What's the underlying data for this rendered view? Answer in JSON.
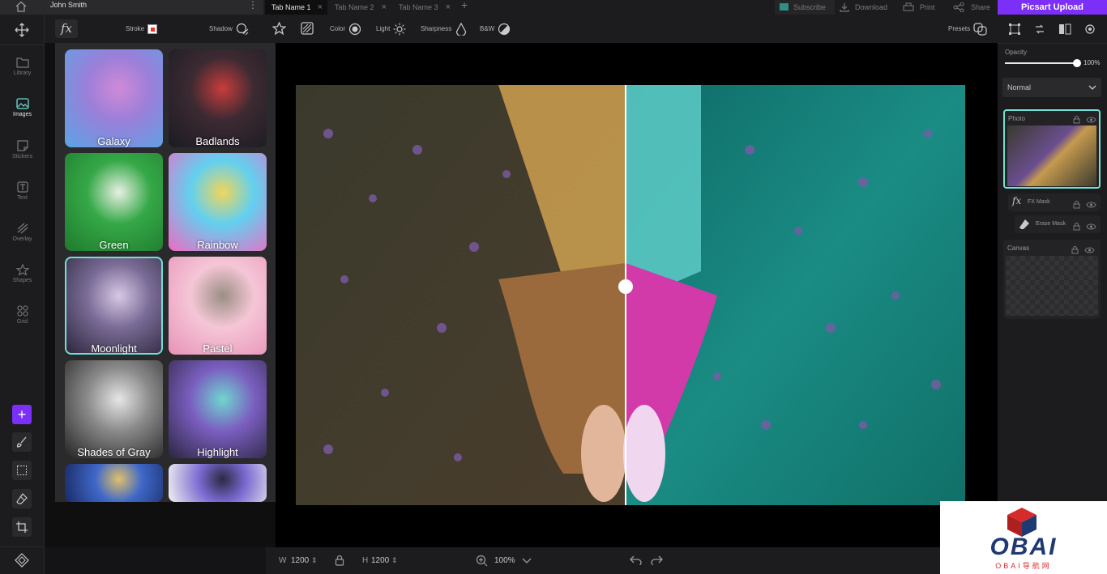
{
  "window": {
    "user_name": "John Smith"
  },
  "tabs": [
    {
      "label": "Tab Name 1",
      "active": true
    },
    {
      "label": "Tab Name 2",
      "active": false
    },
    {
      "label": "Tab Name 3",
      "active": false
    }
  ],
  "top_actions": {
    "subscribe": "Subscribe",
    "download": "Download",
    "print": "Print",
    "share": "Share",
    "upload": "Picsart Upload"
  },
  "effect_tools": {
    "fx_label": "fx",
    "stroke": "Stroke",
    "shadow": "Shadow",
    "color": "Color",
    "light": "Light",
    "sharpness": "Sharpness",
    "bw": "B&W",
    "presets": "Presets"
  },
  "left_rail": [
    {
      "label": "Library",
      "icon": "folder-icon"
    },
    {
      "label": "Images",
      "icon": "image-icon",
      "active": true
    },
    {
      "label": "Stickers",
      "icon": "sticker-icon"
    },
    {
      "label": "Text",
      "icon": "text-icon"
    },
    {
      "label": "Overlay",
      "icon": "overlay-icon"
    },
    {
      "label": "Shapes",
      "icon": "star-icon"
    },
    {
      "label": "Grid",
      "icon": "grid-icon"
    }
  ],
  "effects": [
    {
      "label": "Galaxy",
      "colors": [
        "#5aa4e6",
        "#9b7fd9",
        "#d08ad7"
      ]
    },
    {
      "label": "Badlands",
      "colors": [
        "#1b1b22",
        "#3c2a32",
        "#c83c3c"
      ]
    },
    {
      "label": "Green",
      "colors": [
        "#1e7a2e",
        "#35a847",
        "#e8f0e4"
      ]
    },
    {
      "label": "Rainbow",
      "colors": [
        "#f06ac2",
        "#62d0f0",
        "#f0d65a"
      ]
    },
    {
      "label": "Moonlight",
      "colors": [
        "#2a2338",
        "#7a6c96",
        "#d8c8e6"
      ],
      "selected": true
    },
    {
      "label": "Pastel",
      "colors": [
        "#e892b8",
        "#f5c6d6",
        "#9a8f84"
      ]
    },
    {
      "label": "Shades of Gray",
      "colors": [
        "#222222",
        "#8a8a8a",
        "#e6e6e6"
      ]
    },
    {
      "label": "Highlight",
      "colors": [
        "#2b2540",
        "#7b5fc0",
        "#6fd6d0"
      ]
    },
    {
      "label": "",
      "colors": [
        "#1a2a66",
        "#3f68c8",
        "#e0c06a"
      ]
    },
    {
      "label": "",
      "colors": [
        "#f2f2f2",
        "#7a6ad0",
        "#2a2a44"
      ]
    }
  ],
  "right_panel": {
    "opacity_label": "Opacity",
    "opacity_value": "100%",
    "opacity": 1.0,
    "blend_mode": "Normal",
    "layers": [
      {
        "name": "Photo"
      },
      {
        "name": "FX Mask"
      },
      {
        "name": "Erase Mask"
      },
      {
        "name": "Canvas"
      }
    ]
  },
  "bottom_bar": {
    "width_label": "W",
    "width_value": "1200",
    "height_label": "H",
    "height_value": "1200",
    "zoom": "100%"
  },
  "watermark": {
    "brand": "OBAI",
    "sub": "OBAI导航网"
  },
  "colors": {
    "accent": "#7b2ff7",
    "teal": "#6fe0d3",
    "panel": "#2a2a2c"
  }
}
